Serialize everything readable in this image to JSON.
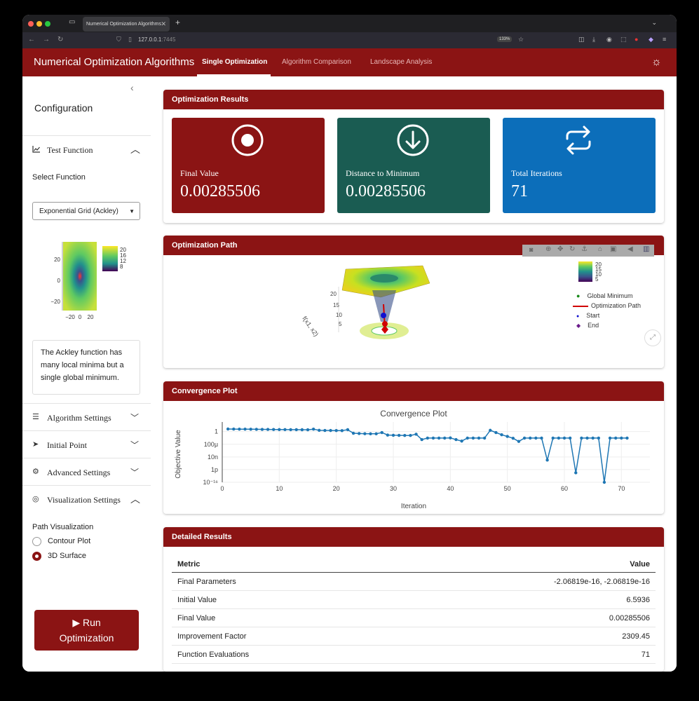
{
  "browser": {
    "tab_title": "Numerical Optimization Algorithms",
    "url_host": "127.0.0.1",
    "url_port": ":7445",
    "zoom": "133%"
  },
  "header": {
    "app_title": "Numerical Optimization Algorithms",
    "nav": [
      "Single Optimization",
      "Algorithm Comparison",
      "Landscape Analysis"
    ],
    "active_index": 0
  },
  "sidebar": {
    "title": "Configuration",
    "test_function": {
      "label": "Test Function",
      "select_label": "Select Function",
      "selected": "Exponential Grid (Ackley)",
      "preview_ticks": [
        "20",
        "0",
        "−20"
      ],
      "preview_xticks": [
        "−20",
        "0",
        "20"
      ],
      "preview_cbar": [
        "20",
        "16",
        "12",
        "8"
      ],
      "description": "The Ackley function has many local minima but a single global minimum."
    },
    "sections": [
      "Algorithm Settings",
      "Initial Point",
      "Advanced Settings",
      "Visualization Settings"
    ],
    "visualization": {
      "label": "Path Visualization",
      "options": [
        "Contour Plot",
        "3D Surface"
      ],
      "selected_index": 1
    },
    "run_button": {
      "icon": "▶",
      "line1": "Run",
      "line2": "Optimization"
    }
  },
  "results": {
    "title": "Optimization Results",
    "cards": [
      {
        "label": "Final Value",
        "value": "0.00285506",
        "color": "#8b1414",
        "icon": "record-icon"
      },
      {
        "label": "Distance to Minimum",
        "value": "0.00285506",
        "color": "#1a5c52",
        "icon": "arrow-down-circle-icon"
      },
      {
        "label": "Total Iterations",
        "value": "71",
        "color": "#0c6eba",
        "icon": "repeat-icon"
      }
    ]
  },
  "path": {
    "title": "Optimization Path",
    "zlabel": "f(x1, x2)",
    "zticks": [
      "20",
      "15",
      "10",
      "5"
    ],
    "cbar": [
      "20",
      "15",
      "10",
      "5"
    ],
    "legend": [
      "Global Minimum",
      "Optimization Path",
      "Start",
      "End"
    ],
    "legend_colors": [
      "#1a8a1a",
      "#d00000",
      "#1010d0",
      "#6a1a8a"
    ]
  },
  "convergence": {
    "title": "Convergence Plot",
    "chart_data": {
      "type": "line",
      "title": "Convergence Plot",
      "xlabel": "Iteration",
      "ylabel": "Objective Value",
      "yscale": "log",
      "xlim": [
        0,
        75
      ],
      "ylim": [
        1e-16,
        50
      ],
      "xticks": [
        0,
        10,
        20,
        30,
        40,
        50,
        60,
        70
      ],
      "yticks": [
        {
          "v": 1,
          "label": "1"
        },
        {
          "v": 0.0001,
          "label": "100μ"
        },
        {
          "v": 1e-08,
          "label": "10n"
        },
        {
          "v": 1e-12,
          "label": "1p"
        },
        {
          "v": 1e-16,
          "label": "10⁻¹⁶"
        }
      ],
      "x": [
        1,
        2,
        3,
        4,
        5,
        6,
        7,
        8,
        9,
        10,
        11,
        12,
        13,
        14,
        15,
        16,
        17,
        18,
        19,
        20,
        21,
        22,
        23,
        24,
        25,
        26,
        27,
        28,
        29,
        30,
        31,
        32,
        33,
        34,
        35,
        36,
        37,
        38,
        39,
        40,
        41,
        42,
        43,
        44,
        45,
        46,
        47,
        48,
        49,
        50,
        51,
        52,
        53,
        54,
        55,
        56,
        57,
        58,
        59,
        60,
        61,
        62,
        63,
        64,
        65,
        66,
        67,
        68,
        69,
        70,
        71
      ],
      "y": [
        6.5,
        6.2,
        6.0,
        5.8,
        5.5,
        5.2,
        5.0,
        4.8,
        4.6,
        4.4,
        4.2,
        4.1,
        4.0,
        3.9,
        3.8,
        6.0,
        2.5,
        2.3,
        2.2,
        2.1,
        2.0,
        4.0,
        0.3,
        0.25,
        0.22,
        0.2,
        0.2,
        0.5,
        0.08,
        0.07,
        0.065,
        0.06,
        0.06,
        0.15,
        0.003,
        0.009,
        0.009,
        0.009,
        0.009,
        0.01,
        0.003,
        0.001,
        0.009,
        0.009,
        0.009,
        0.009,
        2.5,
        0.5,
        0.1,
        0.03,
        0.008,
        0.0008,
        0.009,
        0.009,
        0.009,
        0.009,
        1e-09,
        0.009,
        0.009,
        0.009,
        0.009,
        1e-13,
        0.009,
        0.009,
        0.009,
        0.009,
        1e-16,
        0.009,
        0.009,
        0.009,
        0.009
      ]
    }
  },
  "details": {
    "title": "Detailed Results",
    "headers": [
      "Metric",
      "Value"
    ],
    "rows": [
      [
        "Final Parameters",
        "-2.06819e-16, -2.06819e-16"
      ],
      [
        "Initial Value",
        "6.5936"
      ],
      [
        "Final Value",
        "0.00285506"
      ],
      [
        "Improvement Factor",
        "2309.45"
      ],
      [
        "Function Evaluations",
        "71"
      ]
    ]
  }
}
